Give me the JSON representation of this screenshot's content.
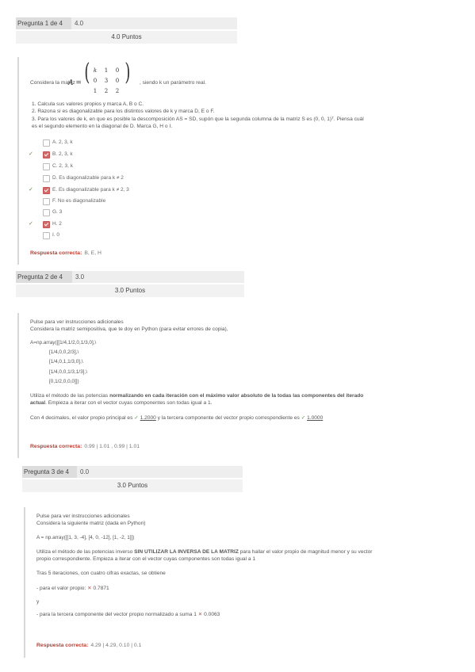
{
  "q1": {
    "header_label": "Pregunta 1 de 4",
    "header_score": "4.0",
    "points": "4.0 Puntos",
    "intro_pre": "Considera la matriz",
    "matrix_lhs": "A =",
    "matrix": [
      [
        "k",
        "1",
        "0"
      ],
      [
        "0",
        "3",
        "0"
      ],
      [
        "1",
        "2",
        "2"
      ]
    ],
    "intro_post": ", siendo k un parámetro real.",
    "items": [
      "1. Calcula sus valores propios y marca A, B o C.",
      "2. Razona si es diagonalizable para los distintos valores de k y marca D, E o F.",
      "3. Para los valores de k, en que es posible la descomposición AS = SD, supón que la segunda columna de la matriz S es (0, 0, 1)ᵀ. Piensa cuál",
      "   es el segundo elemento en la diagonal de D. Marca G, H o I."
    ],
    "options": [
      {
        "text": "A. 2, 3, k",
        "checked": false,
        "tick": false
      },
      {
        "text": "B. 2, 3, k",
        "checked": true,
        "tick": true
      },
      {
        "text": "C. 2, 3, k",
        "checked": false,
        "tick": false
      },
      {
        "text": "D. Es diagonalizable para k ≠ 2",
        "checked": false,
        "tick": false
      },
      {
        "text": "E. Es diagonalizable para k ≠ 2, 3",
        "checked": true,
        "tick": true
      },
      {
        "text": "F. No es diagonalizable",
        "checked": false,
        "tick": false
      },
      {
        "text": "G. 3",
        "checked": false,
        "tick": false
      },
      {
        "text": "H. 2",
        "checked": true,
        "tick": true
      },
      {
        "text": "I. 0",
        "checked": false,
        "tick": false
      }
    ],
    "answer_label": "Respuesta correcta:",
    "answer_value": "B, E, H"
  },
  "q2": {
    "header_label": "Pregunta 2 de 4",
    "header_score": "3.0",
    "points": "3.0 Puntos",
    "l1": "Pulse para ver instrucciones adicionales",
    "l2": "Considera la matriz semipositiva, que te doy en Python (para evitar errores de copia),",
    "code": [
      "A=np.array([[1/4,1/2,0,1/3,0],\\",
      "[1/4,0,0,2/3],\\",
      "[1/4,0,1,1/3,0],\\",
      "[1/4,0,0,1/3,1/3],\\",
      "[0,1/2,0,0,0]])"
    ],
    "p1a": "Utiliza el método de las potencias ",
    "p1b": "normalizando en cada iteración con el máximo valor absoluto de la todas las componentes del iterado",
    "p2a": "actual",
    "p2b": ". Empieza a iterar con el vector cuyas componentes son todas igual a 1.",
    "p3a": "Con 4 decimales, el valor propio principal es",
    "v1": "1.2000",
    "p3b": "y la tercera componente del vector propio correspondiente es",
    "v2": "1.0000",
    "answer_label": "Respuesta correcta:",
    "answer_value": "0.99 | 1.01 , 0.99 | 1.01"
  },
  "q3": {
    "header_label": "Pregunta 3 de 4",
    "header_score": "0.0",
    "points": "3.0 Puntos",
    "l1": "Pulse para ver instrucciones adicionales",
    "l2": "Considera la siguiente matriz (dada en Python)",
    "code": "A = np.array([[1, 3, -4], [4, 0, -12], [1, -2, 1]])",
    "p1a": "Utiliza el método de las potencias inverso ",
    "p1b": "SIN UTILIZAR LA INVERSA DE LA MATRIZ",
    "p1c": " para hallar el valor propio de magnitud menor y su vector",
    "p2": "propio correspondiente. Empieza a iterar con el vector cuyas componentes son todas igual a 1",
    "p3": "Tras 5 iteraciones, con cuatro cifras exactas, se obtiene",
    "p4a": "- para el valor propio:",
    "v1": "0.7871",
    "p5": "y",
    "p6a": "- para la tercera componente del vector propio normalizado a suma 1",
    "v2": "0.0063",
    "answer_label": "Respuesta correcta:",
    "answer_value": "4.29 | 4.29, 0.10 | 0.1"
  }
}
